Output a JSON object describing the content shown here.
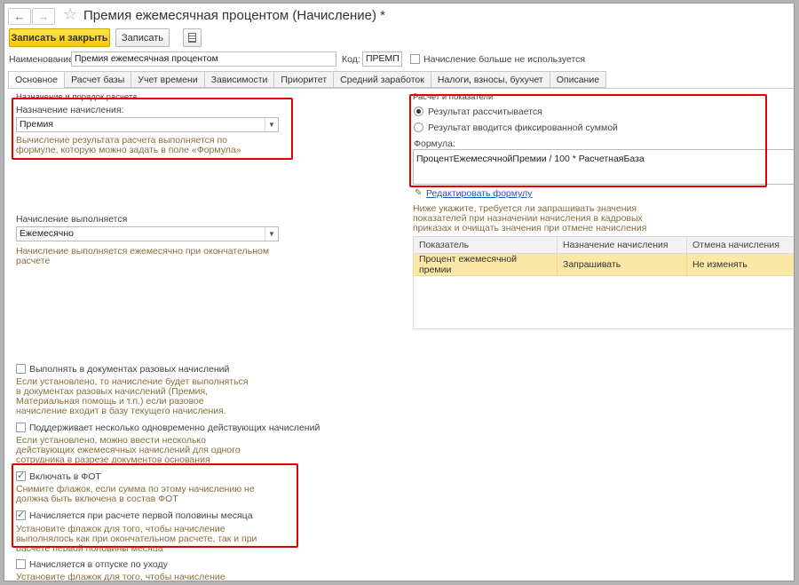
{
  "window": {
    "title": "Премия ежемесячная процентом (Начисление) *"
  },
  "toolbar": {
    "save_close": "Записать и закрыть",
    "save": "Записать"
  },
  "header": {
    "name_label": "Наименование:",
    "name_value": "Премия ежемесячная процентом",
    "code_label": "Код:",
    "code_value": "ПРЕМП",
    "unused_label": "Начисление больше не используется"
  },
  "tabs": [
    {
      "label": "Основное"
    },
    {
      "label": "Расчет базы"
    },
    {
      "label": "Учет времени"
    },
    {
      "label": "Зависимости"
    },
    {
      "label": "Приоритет"
    },
    {
      "label": "Средний заработок"
    },
    {
      "label": "Налоги, взносы, бухучет"
    },
    {
      "label": "Описание"
    }
  ],
  "left": {
    "group_title": "Назначение и порядок расчета",
    "purpose_label": "Назначение начисления:",
    "purpose_value": "Премия",
    "purpose_hint": "Вычисление результата расчета выполняется по формуле, которую можно задать в поле «Формула»",
    "exec_label": "Начисление выполняется",
    "exec_value": "Ежемесячно",
    "exec_hint": "Начисление выполняется ежемесячно при окончательном расчете",
    "cb1_label": "Выполнять в документах разовых начислений",
    "cb1_hint": "Если установлено, то начисление будет выполняться в документах разовых начислений (Премия, Материальная помощь и т.п.) если разовое начисление входит в базу текущего начисления.",
    "cb2_label": "Поддерживает несколько одновременно действующих начислений",
    "cb2_hint": "Если установлено, можно ввести несколько действующих ежемесячных начислений для одного сотрудника в разрезе документов основания",
    "cb3_label": "Включать в ФОТ",
    "cb3_hint": "Снимите флажок, если сумма по этому начислению не должна быть включена в состав ФОТ",
    "cb4_label": "Начисляется при расчете первой половины месяца",
    "cb4_hint": "Установите флажок для того, чтобы начисление выполнялось как при окончательном расчете, так и при расчете первой половины месяца",
    "cb5_label": "Начисляется в отпуске по уходу",
    "cb5_hint": "Установите флажок для того, чтобы начисление выполнялось в"
  },
  "right": {
    "group_title": "Расчет и показатели",
    "radio1": "Результат рассчитывается",
    "radio2": "Результат вводится фиксированной суммой",
    "formula_label": "Формула:",
    "formula_value": "ПроцентЕжемесячнойПремии / 100 * РасчетнаяБаза",
    "edit_link": "Редактировать формулу",
    "indicators_hint": "Ниже укажите, требуется ли запрашивать значения показателей при назначении начисления в кадровых приказах и очищать значения при отмене начисления",
    "table": {
      "headers": [
        "Показатель",
        "Назначение начисления",
        "Отмена начисления"
      ],
      "rows": [
        [
          "Процент ежемесячной премии",
          "Запрашивать",
          "Не изменять"
        ]
      ]
    }
  }
}
